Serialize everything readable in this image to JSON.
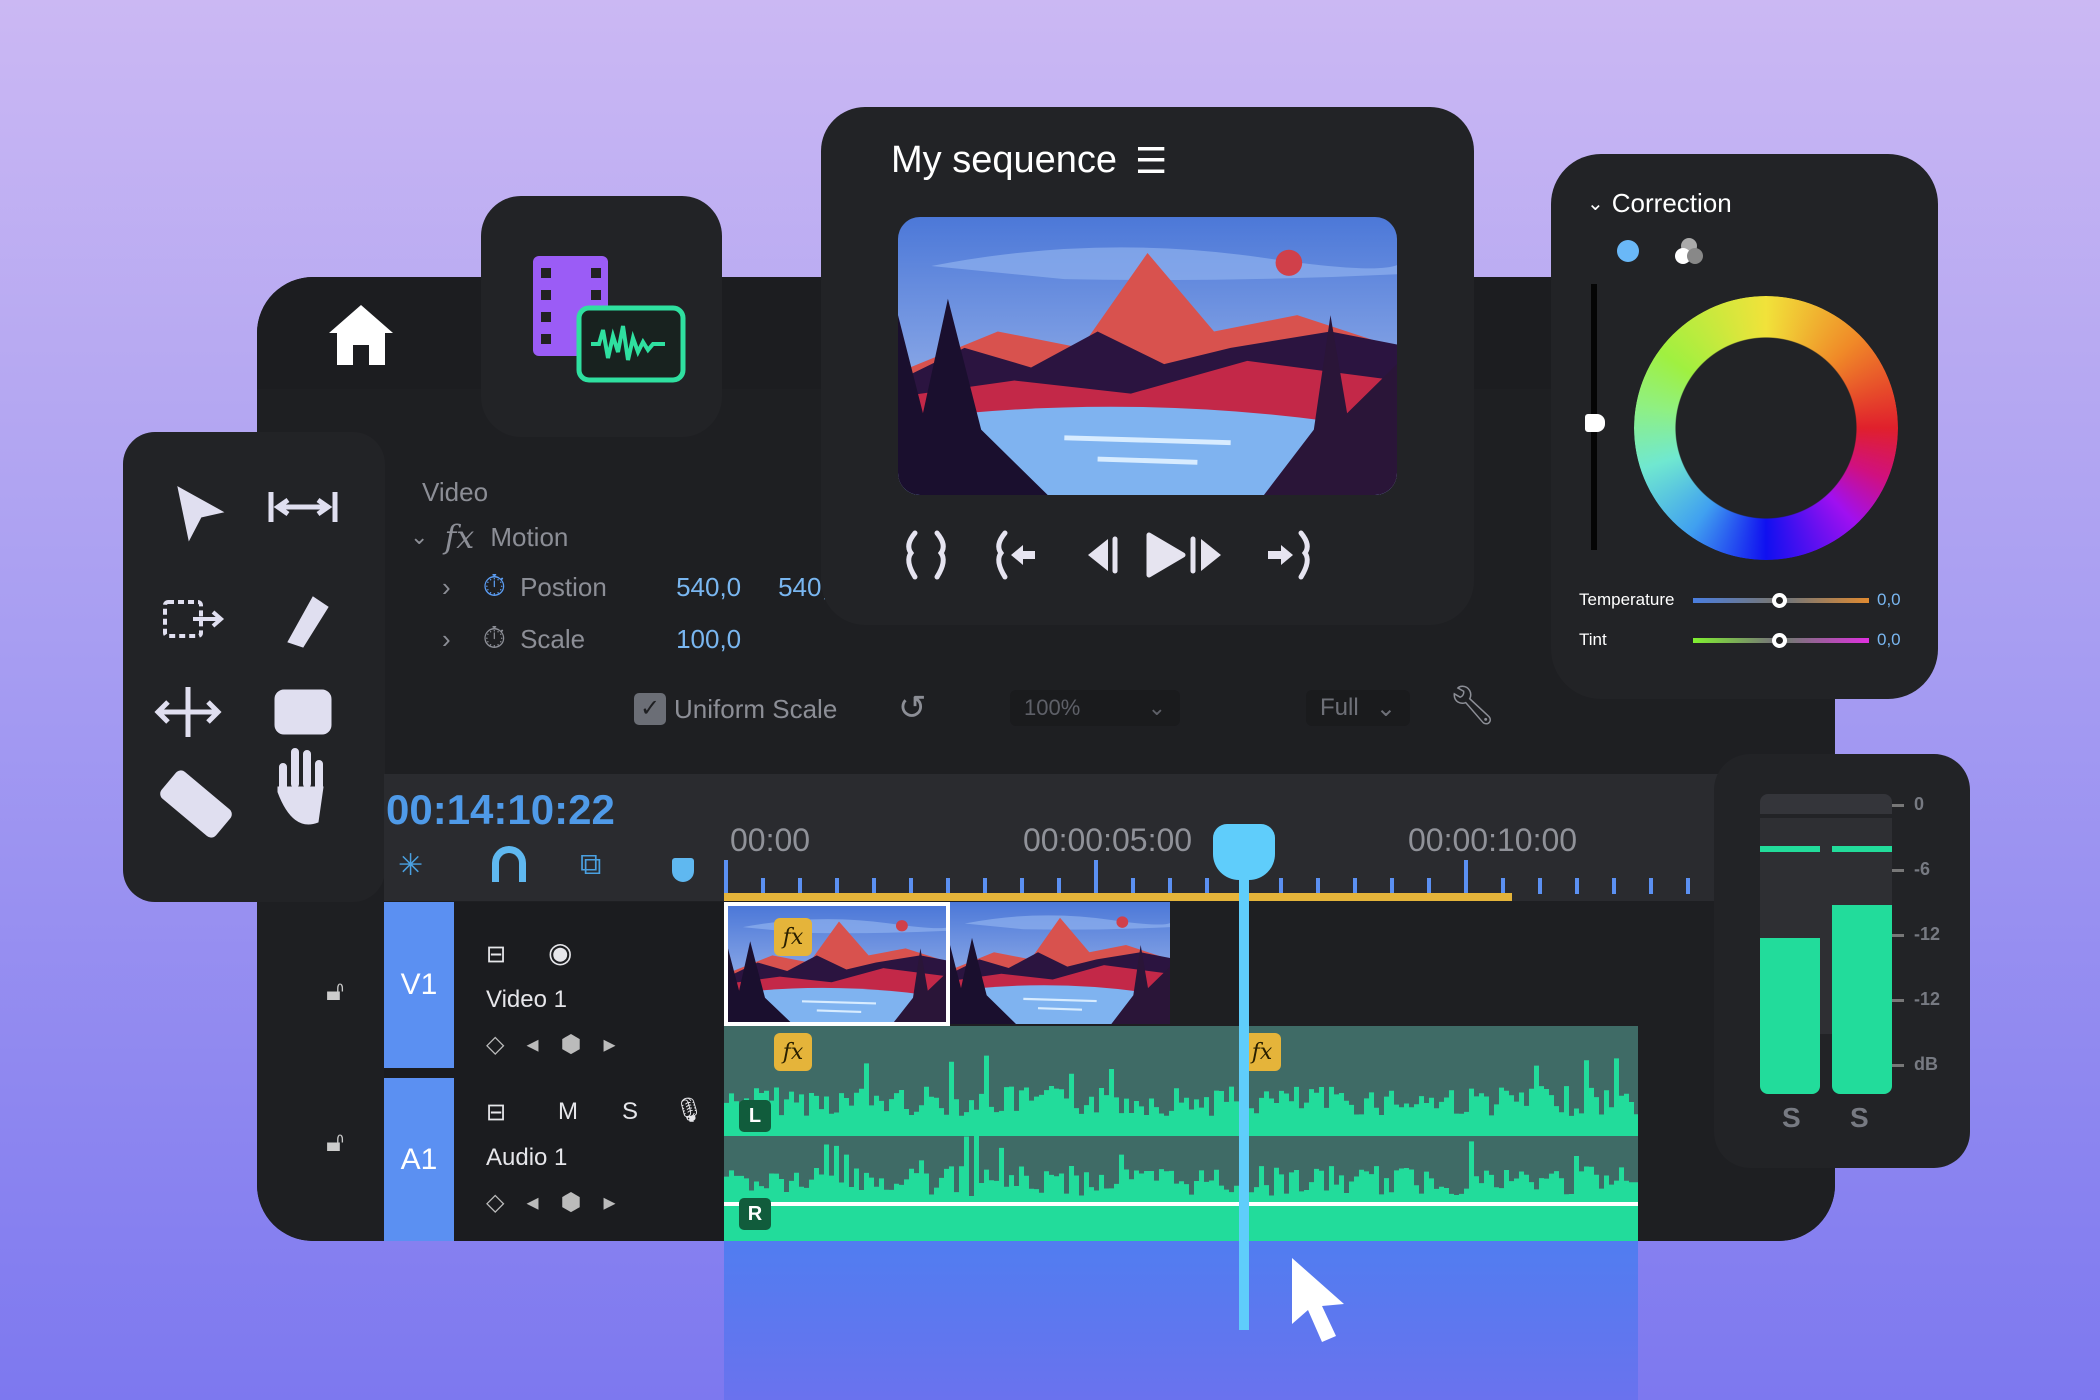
{
  "sequence": {
    "title": "My sequence"
  },
  "effects": {
    "section": "Video",
    "effect": "Motion",
    "params": [
      {
        "label": "Postion",
        "values": [
          "540,0",
          "540,"
        ]
      },
      {
        "label": "Scale",
        "values": [
          "100,0"
        ]
      }
    ],
    "uniform_scale_label": "Uniform Scale",
    "uniform_scale_checked": true,
    "zoom": "100%",
    "quality": "Full"
  },
  "correction": {
    "title": "Correction",
    "sliders": [
      {
        "label": "Temperature",
        "value": "0,0"
      },
      {
        "label": "Tint",
        "value": "0,0"
      }
    ]
  },
  "timeline": {
    "timecode": "00:14:10:22",
    "ruler": [
      "00:00",
      "00:00:05:00",
      "00:00:10:00"
    ],
    "tracks": [
      {
        "id": "V1",
        "name": "Video 1"
      },
      {
        "id": "A1",
        "name": "Audio 1",
        "mute": "M",
        "solo": "S"
      }
    ],
    "channels": [
      "L",
      "R"
    ],
    "fx": "fx"
  },
  "meter": {
    "scale": [
      "0",
      "-6",
      "-12",
      "-12",
      "dB"
    ],
    "channels": [
      "S",
      "S"
    ],
    "levels_db": [
      -13,
      -9.5
    ],
    "peaks_db": [
      -3,
      -3
    ]
  },
  "colors": {
    "accent": "#5b90f2",
    "audio": "#22dc9b",
    "playhead": "#5fcdfb",
    "marker": "#e5b43a"
  }
}
